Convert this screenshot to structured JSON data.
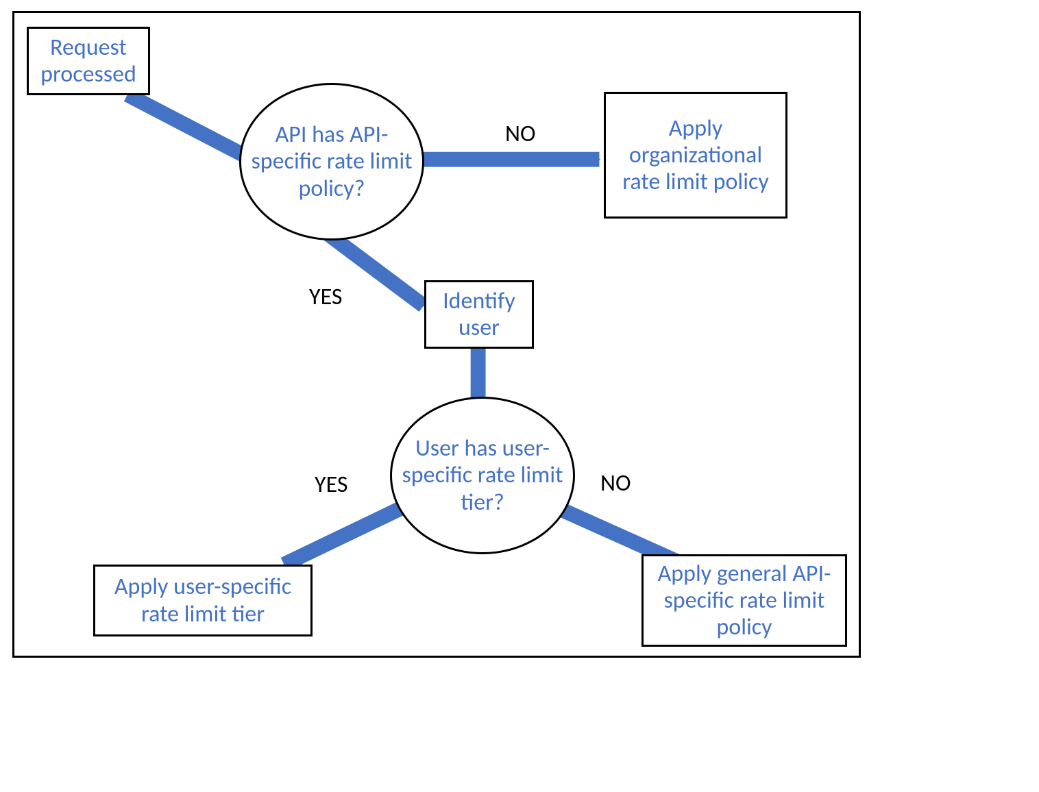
{
  "diagram": {
    "nodes": {
      "start": "Request processed",
      "q_api": "API has API-specific rate limit policy?",
      "apply_org": "Apply organizational rate limit policy",
      "identify_user": "Identify user",
      "q_user": "User has user-specific rate limit tier?",
      "apply_user_tier": "Apply user-specific rate limit tier",
      "apply_general_api": "Apply general API-specific rate limit policy"
    },
    "edges": {
      "q_api_no": "NO",
      "q_api_yes": "YES",
      "q_user_yes": "YES",
      "q_user_no": "NO"
    }
  }
}
